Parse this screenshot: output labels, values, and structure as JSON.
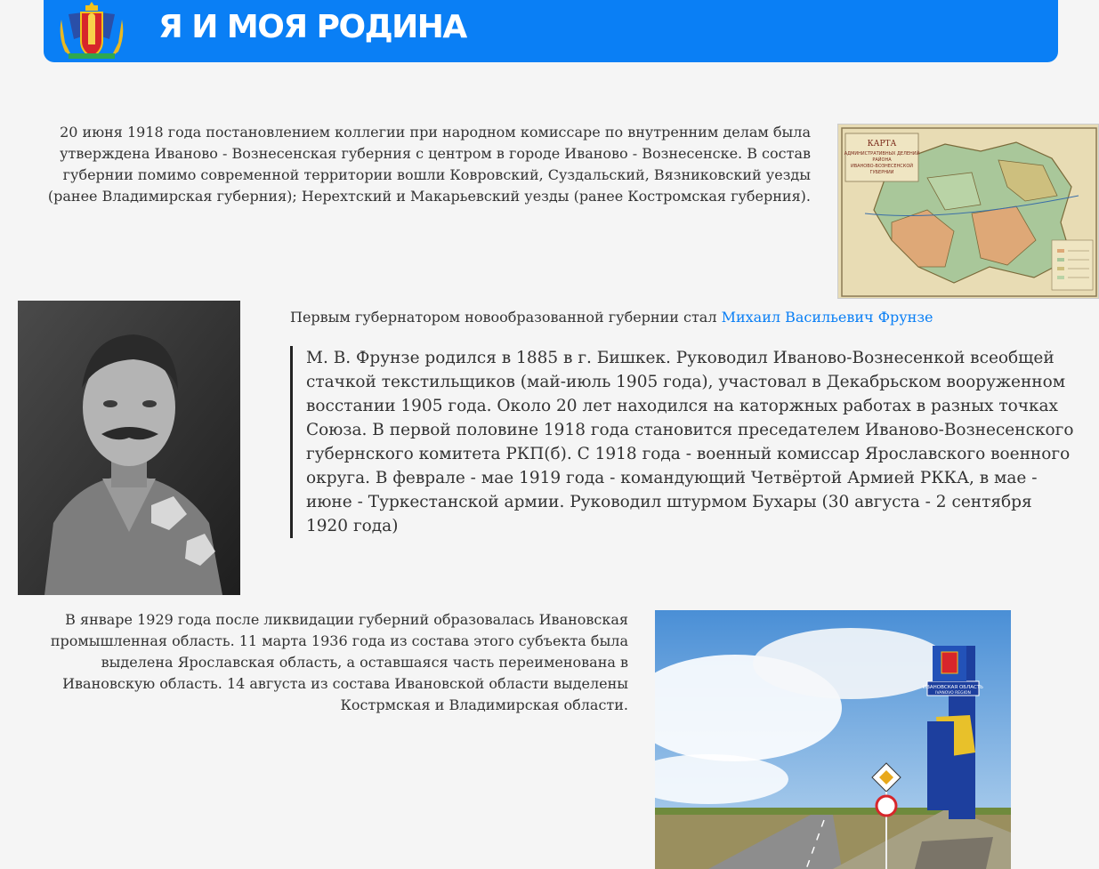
{
  "header": {
    "title": "Я И МОЯ РОДИНА",
    "logo_icon": "ivanovo-coat-of-arms-icon",
    "background": "#0a7ff5"
  },
  "section1": {
    "text": "20 июня 1918 года постановлением коллегии при народном комиссаре по внутренним делам была утверждена Иваново - Вознесенская губерния с центром в городе Иваново - Вознесенске. В состав губернии помимо современной территории вошли Ковровский, Суздальский, Вязниковский уезды (ранее Владимирская губерния); Нерехтский и Макарьевский уезды (ранее Костромская губерния).",
    "map_title": "КАРТА",
    "map_subtitle_1": "АДМИНИСТРАТИВНЫХ ДЕЛЕНИЙ",
    "map_subtitle_2": "РАЙОНА",
    "map_subtitle_3": "ИВАНОВО-ВОЗНЕСЕНСКОЙ",
    "map_subtitle_4": "ГУБЕРНИИ"
  },
  "section2": {
    "intro": "Первым губернатором новообразованной губернии стал ",
    "link_text": "Михаил Васильевич Фрунзе",
    "quote": "М. В. Фрунзе родился в 1885 в г. Бишкек. Руководил Иваново-Вознесенкой всеобщей стачкой текстильщиков (май-июль 1905 года), участовал в Декабрьском вооруженном восстании 1905 года. Около 20 лет находился на каторжных работах в разных точках Союза. В первой половине 1918 года становится преседателем Иваново-Вознесенского губернского комитета РКП(б). С 1918 года - военный комиссар Ярославского военного округа. В феврале - мае 1919 года - командующий Четвёртой Армией РККА, в мае - июне - Туркестанской армии. Руководил штурмом Бухары (30 августа - 2 сентября 1920 года)"
  },
  "section3": {
    "text": "В январе 1929 года после ликвидации губерний образовалась Ивановская промышленная область. 11 марта 1936 года из состава этого субъекта была выделена Ярославская область, а оставшаяся часть переименована в Ивановскую область. 14 августа из состава Ивановской области выделены Кострмская и Владимирская области.",
    "sign_text": "ИВАНОВСКАЯ ОБЛАСТЬ",
    "sign_text_en": "IVANOVO REGION"
  }
}
